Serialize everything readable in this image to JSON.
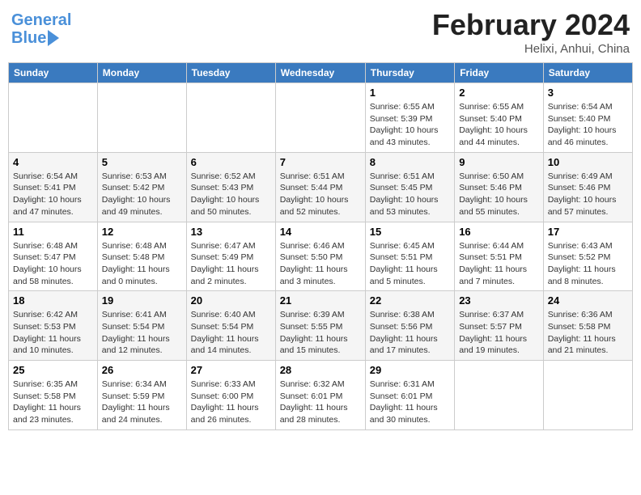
{
  "header": {
    "logo_line1": "General",
    "logo_line2": "Blue",
    "month": "February 2024",
    "location": "Helixi, Anhui, China"
  },
  "weekdays": [
    "Sunday",
    "Monday",
    "Tuesday",
    "Wednesday",
    "Thursday",
    "Friday",
    "Saturday"
  ],
  "weeks": [
    [
      {
        "day": "",
        "info": ""
      },
      {
        "day": "",
        "info": ""
      },
      {
        "day": "",
        "info": ""
      },
      {
        "day": "",
        "info": ""
      },
      {
        "day": "1",
        "info": "Sunrise: 6:55 AM\nSunset: 5:39 PM\nDaylight: 10 hours and 43 minutes."
      },
      {
        "day": "2",
        "info": "Sunrise: 6:55 AM\nSunset: 5:40 PM\nDaylight: 10 hours and 44 minutes."
      },
      {
        "day": "3",
        "info": "Sunrise: 6:54 AM\nSunset: 5:40 PM\nDaylight: 10 hours and 46 minutes."
      }
    ],
    [
      {
        "day": "4",
        "info": "Sunrise: 6:54 AM\nSunset: 5:41 PM\nDaylight: 10 hours and 47 minutes."
      },
      {
        "day": "5",
        "info": "Sunrise: 6:53 AM\nSunset: 5:42 PM\nDaylight: 10 hours and 49 minutes."
      },
      {
        "day": "6",
        "info": "Sunrise: 6:52 AM\nSunset: 5:43 PM\nDaylight: 10 hours and 50 minutes."
      },
      {
        "day": "7",
        "info": "Sunrise: 6:51 AM\nSunset: 5:44 PM\nDaylight: 10 hours and 52 minutes."
      },
      {
        "day": "8",
        "info": "Sunrise: 6:51 AM\nSunset: 5:45 PM\nDaylight: 10 hours and 53 minutes."
      },
      {
        "day": "9",
        "info": "Sunrise: 6:50 AM\nSunset: 5:46 PM\nDaylight: 10 hours and 55 minutes."
      },
      {
        "day": "10",
        "info": "Sunrise: 6:49 AM\nSunset: 5:46 PM\nDaylight: 10 hours and 57 minutes."
      }
    ],
    [
      {
        "day": "11",
        "info": "Sunrise: 6:48 AM\nSunset: 5:47 PM\nDaylight: 10 hours and 58 minutes."
      },
      {
        "day": "12",
        "info": "Sunrise: 6:48 AM\nSunset: 5:48 PM\nDaylight: 11 hours and 0 minutes."
      },
      {
        "day": "13",
        "info": "Sunrise: 6:47 AM\nSunset: 5:49 PM\nDaylight: 11 hours and 2 minutes."
      },
      {
        "day": "14",
        "info": "Sunrise: 6:46 AM\nSunset: 5:50 PM\nDaylight: 11 hours and 3 minutes."
      },
      {
        "day": "15",
        "info": "Sunrise: 6:45 AM\nSunset: 5:51 PM\nDaylight: 11 hours and 5 minutes."
      },
      {
        "day": "16",
        "info": "Sunrise: 6:44 AM\nSunset: 5:51 PM\nDaylight: 11 hours and 7 minutes."
      },
      {
        "day": "17",
        "info": "Sunrise: 6:43 AM\nSunset: 5:52 PM\nDaylight: 11 hours and 8 minutes."
      }
    ],
    [
      {
        "day": "18",
        "info": "Sunrise: 6:42 AM\nSunset: 5:53 PM\nDaylight: 11 hours and 10 minutes."
      },
      {
        "day": "19",
        "info": "Sunrise: 6:41 AM\nSunset: 5:54 PM\nDaylight: 11 hours and 12 minutes."
      },
      {
        "day": "20",
        "info": "Sunrise: 6:40 AM\nSunset: 5:54 PM\nDaylight: 11 hours and 14 minutes."
      },
      {
        "day": "21",
        "info": "Sunrise: 6:39 AM\nSunset: 5:55 PM\nDaylight: 11 hours and 15 minutes."
      },
      {
        "day": "22",
        "info": "Sunrise: 6:38 AM\nSunset: 5:56 PM\nDaylight: 11 hours and 17 minutes."
      },
      {
        "day": "23",
        "info": "Sunrise: 6:37 AM\nSunset: 5:57 PM\nDaylight: 11 hours and 19 minutes."
      },
      {
        "day": "24",
        "info": "Sunrise: 6:36 AM\nSunset: 5:58 PM\nDaylight: 11 hours and 21 minutes."
      }
    ],
    [
      {
        "day": "25",
        "info": "Sunrise: 6:35 AM\nSunset: 5:58 PM\nDaylight: 11 hours and 23 minutes."
      },
      {
        "day": "26",
        "info": "Sunrise: 6:34 AM\nSunset: 5:59 PM\nDaylight: 11 hours and 24 minutes."
      },
      {
        "day": "27",
        "info": "Sunrise: 6:33 AM\nSunset: 6:00 PM\nDaylight: 11 hours and 26 minutes."
      },
      {
        "day": "28",
        "info": "Sunrise: 6:32 AM\nSunset: 6:01 PM\nDaylight: 11 hours and 28 minutes."
      },
      {
        "day": "29",
        "info": "Sunrise: 6:31 AM\nSunset: 6:01 PM\nDaylight: 11 hours and 30 minutes."
      },
      {
        "day": "",
        "info": ""
      },
      {
        "day": "",
        "info": ""
      }
    ]
  ]
}
